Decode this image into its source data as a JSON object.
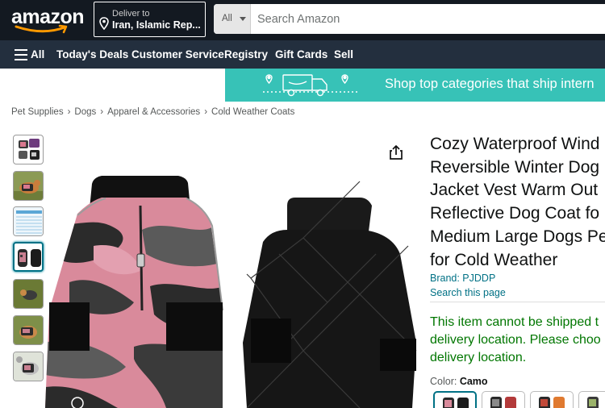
{
  "header": {
    "logo": "amazon",
    "deliver_line1": "Deliver to",
    "deliver_line2": "Iran, Islamic Rep...",
    "search_category": "All",
    "search_placeholder": "Search Amazon"
  },
  "nav": {
    "all_label": "All",
    "links": [
      "Today's Deals",
      "Customer Service",
      "Registry",
      "Gift Cards",
      "Sell"
    ]
  },
  "banner": {
    "text": "Shop top categories that ship intern"
  },
  "breadcrumb": [
    "Pet Supplies",
    "Dogs",
    "Apparel & Accessories",
    "Cold Weather Coats"
  ],
  "product": {
    "title_lines": [
      "Cozy Waterproof Wind",
      "Reversible Winter Dog",
      "Jacket Vest Warm Out",
      "Reflective Dog Coat fo",
      "Medium Large Dogs Pe",
      "for Cold Weather"
    ],
    "brand": "Brand: PJDDP",
    "search_page": "Search this page",
    "shipping_warning_lines": [
      "This item cannot be shipped t",
      "delivery location. Please choo",
      "delivery location."
    ],
    "color_label": "Color: ",
    "color_value": "Camo"
  },
  "colors": {
    "header_bg": "#131921",
    "nav_bg": "#232f3e",
    "banner_bg": "#37c2b7",
    "link": "#007185",
    "warning": "#007600",
    "accent": "#ff9900"
  }
}
